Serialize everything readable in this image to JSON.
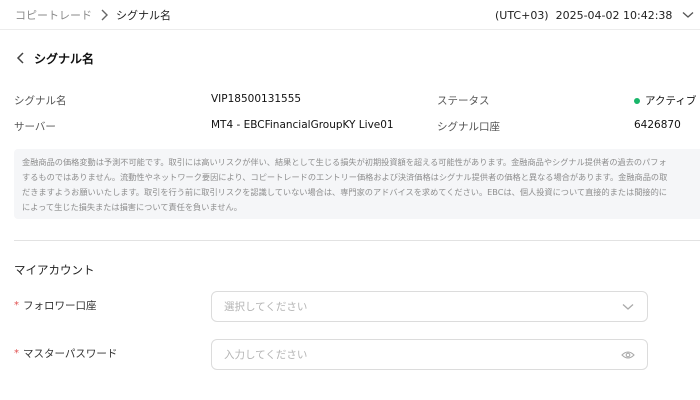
{
  "breadcrumb": {
    "parent": "コピートレード",
    "current": "シグナル名"
  },
  "header": {
    "datetime": "(UTC+03)  2025-04-02 10:42:38"
  },
  "page": {
    "title": "シグナル名"
  },
  "info": {
    "signal_name_label": "シグナル名",
    "signal_name_value": "VIP18500131555",
    "server_label": "サーバー",
    "server_value": "MT4 - EBCFinancialGroupKY Live01",
    "status_label": "ステータス",
    "status_value": "アクティブ",
    "signal_account_label": "シグナル口座",
    "signal_account_value": "6426870"
  },
  "notice": {
    "line1": "金融商品の価格変動は予測不可能です。取引には高いリスクが伴い、結果として生じる損失が初期投資額を超える可能性があります。金融商品やシグナル提供者の過去のパフォ",
    "line2": "するものではありません。流動性やネットワーク要因により、コピートレードのエントリー価格および決済価格はシグナル提供者の価格と異なる場合があります。金融商品の取",
    "line3": "だきますようお願いいたします。取引を行う前に取引リスクを認識していない場合は、専門家のアドバイスを求めてください。EBCは、個人投資について直接的または間接的に",
    "line4": "によって生じた損失または損害について責任を負いません。"
  },
  "account": {
    "section_title": "マイアカウント",
    "follower_label": "フォロワー口座",
    "follower_placeholder": "選択してください",
    "password_label": "マスターパスワード",
    "password_placeholder": "入力してください"
  },
  "colors": {
    "status_active": "#19b66a",
    "required": "#e05050"
  }
}
